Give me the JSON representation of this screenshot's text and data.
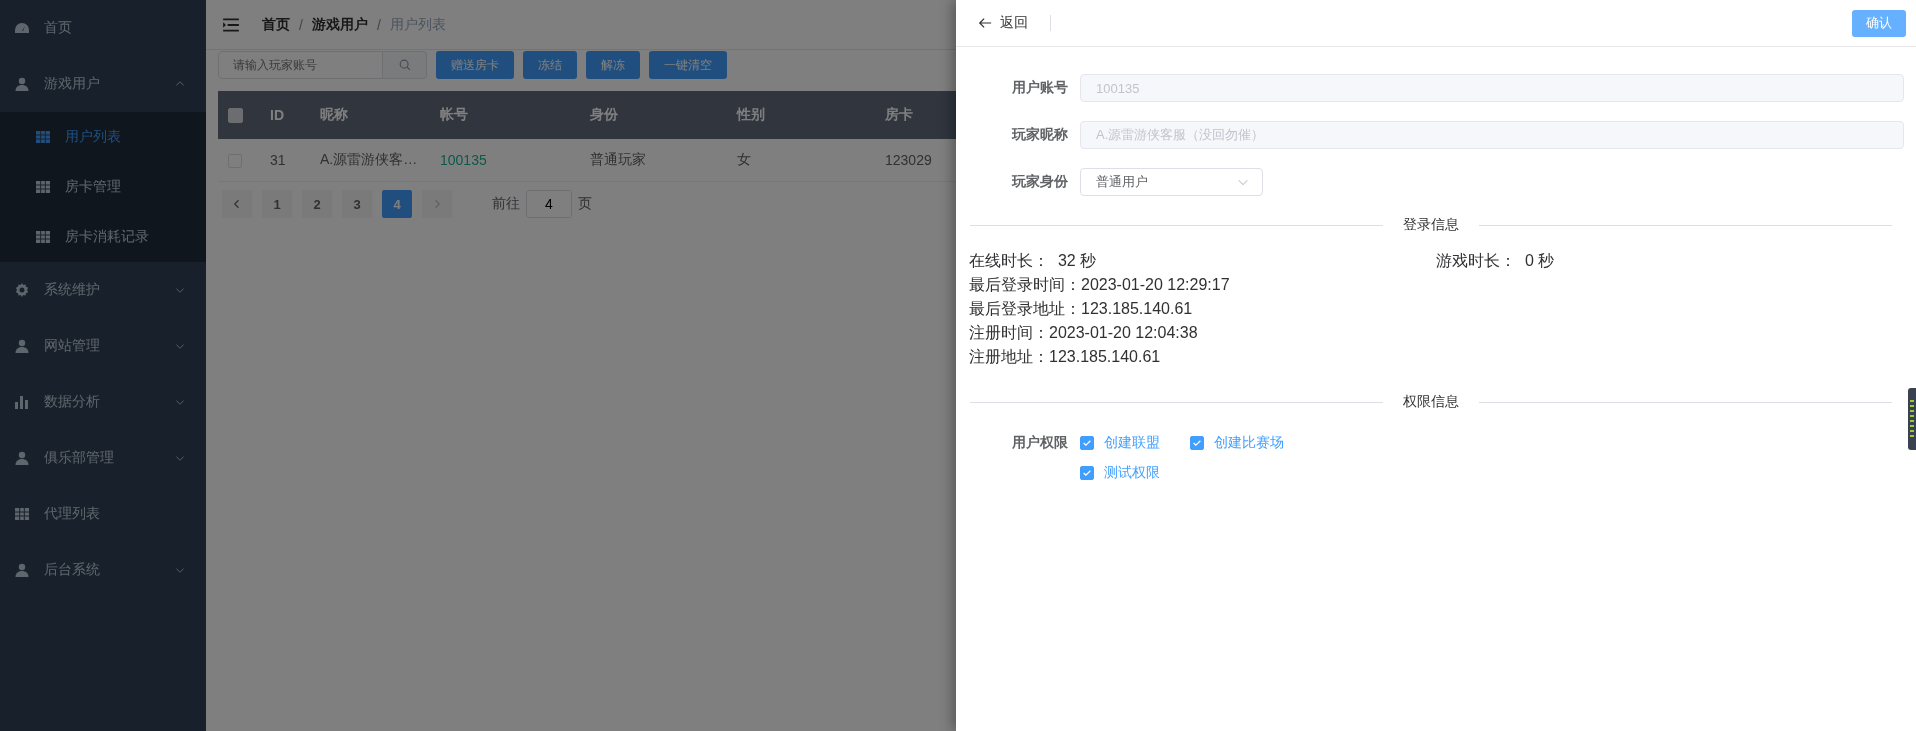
{
  "sidebar": {
    "items": [
      {
        "label": "首页",
        "kind": "dashboard",
        "expandable": false,
        "selected": false
      },
      {
        "label": "游戏用户",
        "kind": "user",
        "expandable": true,
        "expanded": true,
        "selected": false,
        "children": [
          {
            "label": "用户列表",
            "kind": "table",
            "selected": true
          },
          {
            "label": "房卡管理",
            "kind": "table",
            "selected": false
          },
          {
            "label": "房卡消耗记录",
            "kind": "table",
            "selected": false
          }
        ]
      },
      {
        "label": "系统维护",
        "kind": "gear",
        "expandable": true,
        "expanded": false,
        "selected": false
      },
      {
        "label": "网站管理",
        "kind": "user",
        "expandable": true,
        "expanded": false,
        "selected": false
      },
      {
        "label": "数据分析",
        "kind": "chart",
        "expandable": true,
        "expanded": false,
        "selected": false
      },
      {
        "label": "俱乐部管理",
        "kind": "user",
        "expandable": true,
        "expanded": false,
        "selected": false
      },
      {
        "label": "代理列表",
        "kind": "table",
        "expandable": false,
        "selected": false
      },
      {
        "label": "后台系统",
        "kind": "user",
        "expandable": true,
        "expanded": false,
        "selected": false
      }
    ]
  },
  "breadcrumb": [
    "首页",
    "游戏用户",
    "用户列表"
  ],
  "breadcrumb_separator": "/",
  "toolbar": {
    "search": {
      "placeholder": "请输入玩家账号"
    },
    "buttons": [
      "赠送房卡",
      "冻结",
      "解冻",
      "一键清空"
    ]
  },
  "table": {
    "header_checked": false,
    "columns": [
      "ID",
      "昵称",
      "帐号",
      "身份",
      "性别",
      "房卡"
    ],
    "rows": [
      {
        "checked": false,
        "cells": [
          {
            "text": "31",
            "kind": "text"
          },
          {
            "text": "A.源雷游侠客…",
            "kind": "text"
          },
          {
            "text": "100135",
            "kind": "link"
          },
          {
            "text": "普通玩家",
            "kind": "text"
          },
          {
            "text": "女",
            "kind": "text"
          },
          {
            "text": "123029",
            "kind": "text"
          }
        ]
      }
    ]
  },
  "pagination": {
    "prev_disabled": false,
    "next_disabled": true,
    "pages": [
      {
        "label": "1",
        "selected": false
      },
      {
        "label": "2",
        "selected": false
      },
      {
        "label": "3",
        "selected": false
      },
      {
        "label": "4",
        "selected": true
      }
    ],
    "jump_label": "前往",
    "jump_value": "4",
    "jump_suffix": "页"
  },
  "drawer": {
    "back": "返回",
    "confirm": "确认",
    "fields": [
      {
        "label": "用户账号",
        "kind": "input",
        "value": "100135",
        "disabled": true
      },
      {
        "label": "玩家昵称",
        "kind": "input",
        "value": "A.源雷游侠客服（没回勿催）",
        "disabled": true
      },
      {
        "label": "玩家身份",
        "kind": "select",
        "value": "普通用户",
        "disabled": false
      }
    ],
    "login_info": {
      "title": "登录信息",
      "rows": [
        [
          "在线时长：  32 秒",
          "游戏时长：  0 秒"
        ],
        [
          "最后登录时间：2023-01-20 12:29:17"
        ],
        [
          "最后登录地址：123.185.140.61"
        ],
        [
          "注册时间：2023-01-20 12:04:38"
        ],
        [
          "注册地址：123.185.140.61"
        ]
      ]
    },
    "permissions": {
      "title": "权限信息",
      "label": "用户权限",
      "options": [
        {
          "label": "创建联盟",
          "checked": true
        },
        {
          "label": "创建比赛场",
          "checked": true
        },
        {
          "label": "测试权限",
          "checked": true
        }
      ]
    }
  }
}
